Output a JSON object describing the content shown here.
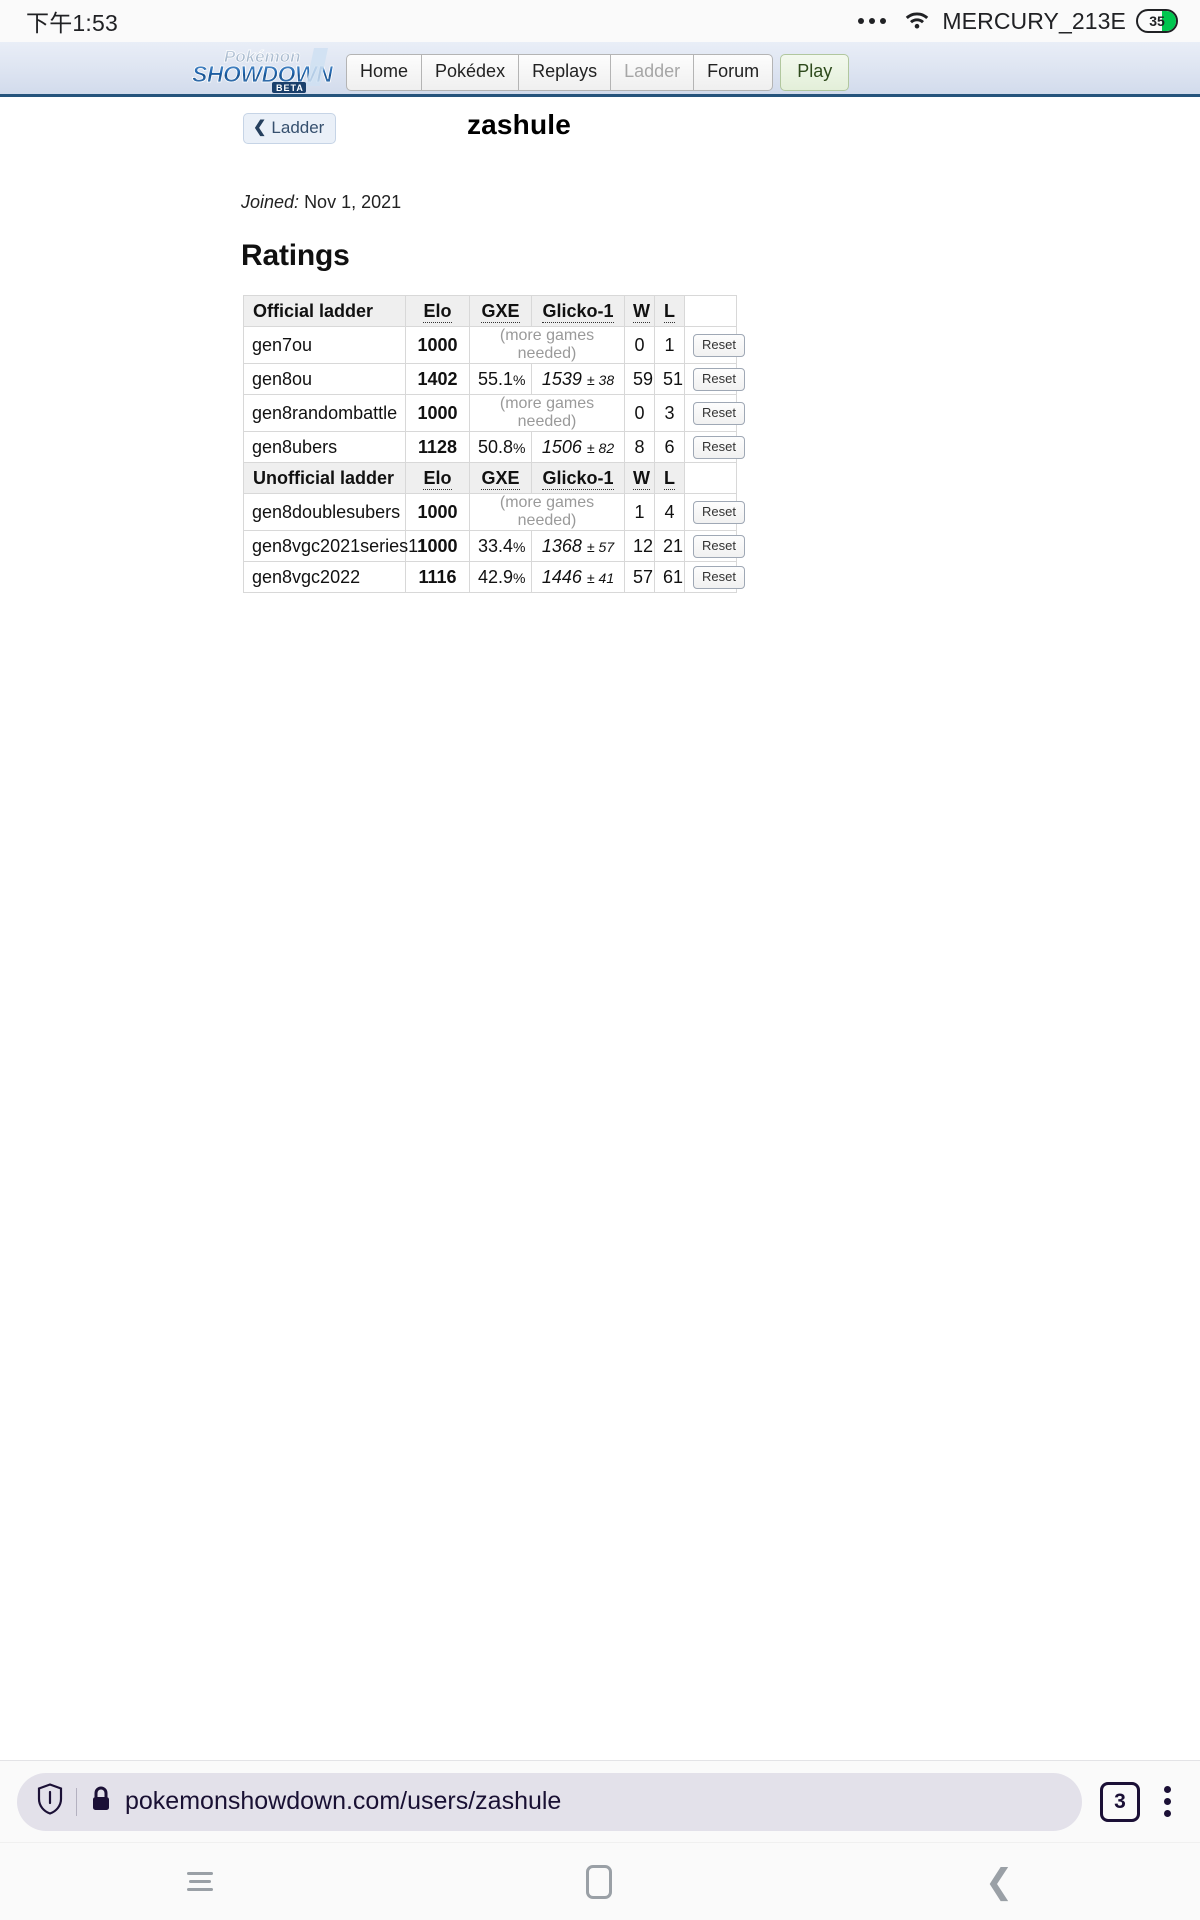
{
  "status_bar": {
    "clock": "下午1:53",
    "overflow_icon": "more-dots-icon",
    "wifi_icon": "wifi-icon",
    "ssid": "MERCURY_213E",
    "battery_level": "35"
  },
  "site_header": {
    "logo_top": "Pokémon",
    "logo_main": "SHOWDOWN",
    "logo_badge": "BETA",
    "nav": [
      {
        "label": "Home",
        "state": "normal"
      },
      {
        "label": "Pokédex",
        "state": "normal"
      },
      {
        "label": "Replays",
        "state": "normal"
      },
      {
        "label": "Ladder",
        "state": "disabled"
      },
      {
        "label": "Forum",
        "state": "normal"
      },
      {
        "label": "Play",
        "state": "accent"
      }
    ]
  },
  "profile": {
    "back_label": "Ladder",
    "back_chevron": "chevron-left-icon",
    "username": "zashule",
    "joined_label": "Joined:",
    "joined_value": "Nov 1, 2021",
    "ratings_heading": "Ratings"
  },
  "ratings_table": {
    "columns": [
      "Elo",
      "GXE",
      "Glicko-1",
      "W",
      "L"
    ],
    "sections": [
      {
        "header": "Official ladder",
        "rows": [
          {
            "format": "gen7ou",
            "elo": "1000",
            "gxe": "(more games needed)",
            "gxe_empty": true,
            "glicko": "",
            "dev": "",
            "w": "0",
            "l": "1",
            "action": "Reset"
          },
          {
            "format": "gen8ou",
            "elo": "1402",
            "gxe": "55.1",
            "gxe_empty": false,
            "glicko": "1539",
            "dev": "± 38",
            "w": "59",
            "l": "51",
            "action": "Reset"
          },
          {
            "format": "gen8randombattle",
            "elo": "1000",
            "gxe": "(more games needed)",
            "gxe_empty": true,
            "glicko": "",
            "dev": "",
            "w": "0",
            "l": "3",
            "action": "Reset"
          },
          {
            "format": "gen8ubers",
            "elo": "1128",
            "gxe": "50.8",
            "gxe_empty": false,
            "glicko": "1506",
            "dev": "± 82",
            "w": "8",
            "l": "6",
            "action": "Reset"
          }
        ]
      },
      {
        "header": "Unofficial ladder",
        "rows": [
          {
            "format": "gen8doublesubers",
            "elo": "1000",
            "gxe": "(more games needed)",
            "gxe_empty": true,
            "glicko": "",
            "dev": "",
            "w": "1",
            "l": "4",
            "action": "Reset"
          },
          {
            "format": "gen8vgc2021series11",
            "elo": "1000",
            "gxe": "33.4",
            "gxe_empty": false,
            "glicko": "1368",
            "dev": "± 57",
            "w": "12",
            "l": "21",
            "action": "Reset"
          },
          {
            "format": "gen8vgc2022",
            "elo": "1116",
            "gxe": "42.9",
            "gxe_empty": false,
            "glicko": "1446",
            "dev": "± 41",
            "w": "57",
            "l": "61",
            "action": "Reset"
          }
        ]
      }
    ],
    "percent_sign": "%"
  },
  "browser_bar": {
    "shield_icon": "shield-icon",
    "lock_icon": "lock-icon",
    "url": "pokemonshowdown.com/users/zashule",
    "tab_count": "3",
    "menu_icon": "kebab-menu-icon"
  },
  "android_nav": {
    "recent_icon": "recent-apps-icon",
    "home_icon": "home-icon",
    "back_icon": "back-icon"
  },
  "colors": {
    "accent_blue": "#26547c",
    "play_green": "#e3efd9",
    "battery_green": "#00c64f",
    "omnibox_bg": "#e3e1ea"
  }
}
